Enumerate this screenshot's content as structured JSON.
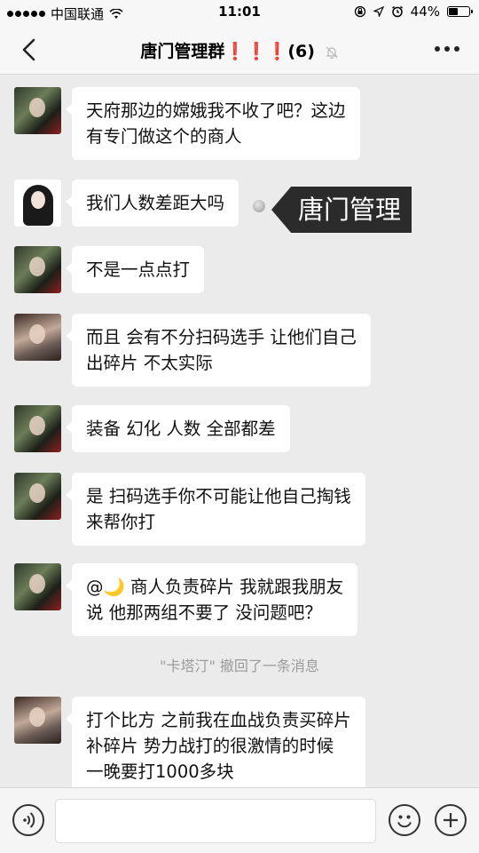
{
  "status_bar": {
    "carrier": "中国联通",
    "time": "11:01",
    "battery_text": "44%",
    "battery_level": 0.44,
    "icons": [
      "signal-dots",
      "wifi-icon",
      "lock-rotation-icon",
      "location-icon",
      "alarm-icon",
      "battery-icon"
    ]
  },
  "nav": {
    "title": "唐门管理群❗️❗️❗️(6)",
    "back_icon": "chevron-left-icon",
    "mute_icon": "bell-muted-icon",
    "more_icon": "more-dots-icon"
  },
  "messages": [
    {
      "avatar": "avatar-a",
      "text": "天府那边的嫦娥我不收了吧？这边\n有专门做这个的商人"
    },
    {
      "avatar": "avatar-b",
      "text": "我们人数差距大吗"
    },
    {
      "avatar": "avatar-a",
      "text": "不是一点点打"
    },
    {
      "avatar": "avatar-c",
      "text": "而且 会有不分扫码选手 让他们自己\n出碎片 不太实际"
    },
    {
      "avatar": "avatar-a",
      "text": "装备 幻化 人数 全部都差"
    },
    {
      "avatar": "avatar-a",
      "text": "是 扫码选手你不可能让他自己掏钱\n来帮你打"
    },
    {
      "avatar": "avatar-a",
      "text": "@🌙 商人负责碎片 我就跟我朋友\n说 他那两组不要了 没问题吧？"
    },
    {
      "avatar": "avatar-c",
      "text": "打个比方 之前我在血战负责买碎片\n 补碎片  势力战打的很激情的时候\n一晚要打1000多块"
    }
  ],
  "overlay_label": "唐门管理",
  "system_notice": "\"卡塔汀\" 撤回了一条消息",
  "input_bar": {
    "voice_icon": "voice-icon",
    "emoji_icon": "emoji-icon",
    "plus_icon": "plus-icon",
    "placeholder": ""
  },
  "colors": {
    "background": "#ebebeb",
    "bubble": "#ffffff",
    "nav_bg": "#f7f7f7",
    "overlay_bg": "#2b2b2b"
  }
}
